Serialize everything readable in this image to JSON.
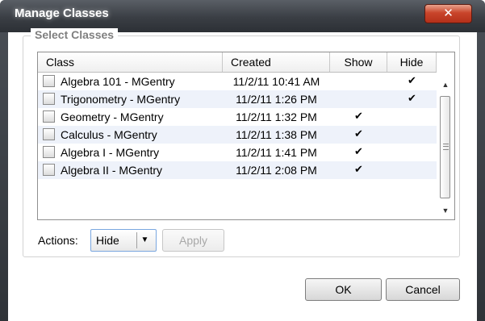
{
  "window": {
    "title": "Manage Classes",
    "close_glyph": "✕"
  },
  "select_classes": {
    "legend": "Select Classes",
    "columns": {
      "class": "Class",
      "created": "Created",
      "show": "Show",
      "hide": "Hide"
    },
    "rows": [
      {
        "class": "Algebra 101 - MGentry",
        "created": "11/2/11 10:41 AM",
        "show": "",
        "hide": "✔"
      },
      {
        "class": "Trigonometry - MGentry",
        "created": "11/2/11 1:26 PM",
        "show": "",
        "hide": "✔"
      },
      {
        "class": "Geometry - MGentry",
        "created": "11/2/11 1:32 PM",
        "show": "✔",
        "hide": ""
      },
      {
        "class": "Calculus - MGentry",
        "created": "11/2/11 1:38 PM",
        "show": "✔",
        "hide": ""
      },
      {
        "class": "Algebra I - MGentry",
        "created": "11/2/11 1:41 PM",
        "show": "✔",
        "hide": ""
      },
      {
        "class": "Algebra II - MGentry",
        "created": "11/2/11 2:08 PM",
        "show": "✔",
        "hide": ""
      }
    ],
    "scroll_up_glyph": "▲",
    "scroll_down_glyph": "▼"
  },
  "actions": {
    "label": "Actions:",
    "selected": "Hide",
    "dropdown_glyph": "▼",
    "apply_label": "Apply"
  },
  "footer": {
    "ok_label": "OK",
    "cancel_label": "Cancel"
  },
  "colors": {
    "titlebar": "#3a3e44",
    "close_button": "#c9452b",
    "row_alt": "#eef2fa",
    "focus_border": "#7aa7e0"
  },
  "icons": {
    "close": "close-icon",
    "checkbox": "checkbox-icon",
    "checkmark": "checkmark-icon",
    "dropdown": "chevron-down-icon"
  }
}
